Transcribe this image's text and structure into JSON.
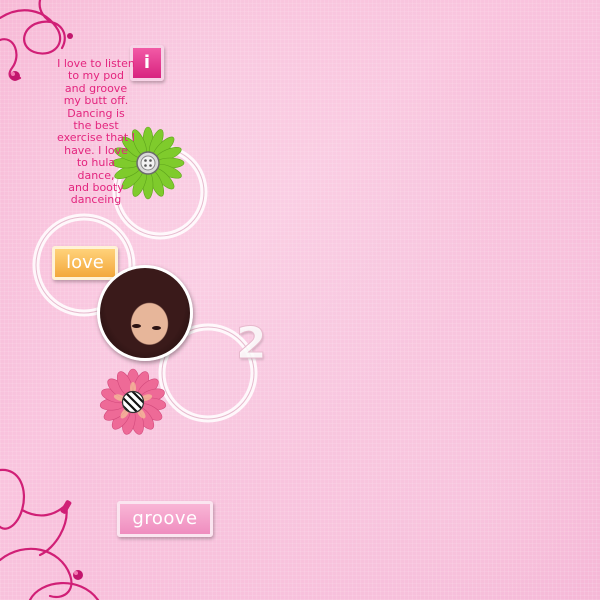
{
  "journal_text": "I love to listen\nto my pod\nand groove\nmy butt off.\nDancing is\nthe best\nexercise that I\nhave. I love\nto hula\ndance,\nand booty\ndanceing",
  "tiles": {
    "i_letter": "i",
    "love_word": "love",
    "groove_word": "groove",
    "two_number": "2"
  },
  "icons": {
    "headphones": "earbud-cord-icon",
    "flower_green": "green-flower-icon",
    "flower_pink": "pink-flower-icon"
  },
  "colors": {
    "background": "#f8bcd9",
    "journal_text": "#e3257e",
    "earbud_cord": "#d01f76",
    "love_tile": "#f6b24a",
    "groove_tile": "#f29ac6",
    "i_tile": "#e8398f",
    "green_flower": "#8ed63a",
    "pink_flower": "#ef6e9a"
  }
}
